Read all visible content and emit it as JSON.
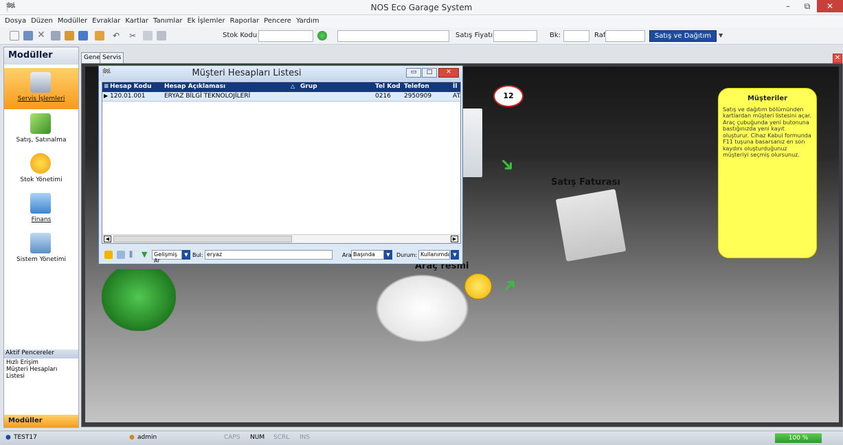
{
  "window": {
    "title": "NOS Eco Garage System",
    "controls": [
      "–",
      "⧉",
      "✕"
    ]
  },
  "menu": [
    "Dosya",
    "Düzen",
    "Modüller",
    "Evraklar",
    "Kartlar",
    "Tanımlar",
    "Ek İşlemler",
    "Raporlar",
    "Pencere",
    "Yardım"
  ],
  "toolbar": {
    "stok_kodu_label": "Stok Kodu",
    "stok_kodu_value": "",
    "satis_fiyati_label": "Satış Fiyatı",
    "bk_label": "Bk:",
    "raf_label": "Raf",
    "satis_dagitim": "Satış ve Dağıtım"
  },
  "sidebar": {
    "title": "Modüller",
    "modules": [
      {
        "label": "Servis İşlemleri",
        "icon": "wrench-icon"
      },
      {
        "label": "Satış, Satınalma",
        "icon": "pen-check-icon"
      },
      {
        "label": "Stok Yönetimi",
        "icon": "gear-icon"
      },
      {
        "label": "Finans",
        "icon": "folder-icon"
      },
      {
        "label": "Sistem Yönetimi",
        "icon": "system-icon"
      }
    ],
    "aktif_title": "Aktif Pencereler",
    "aktif_items": [
      "Hızlı Erişim",
      "Müşteri Hesapları Listesi"
    ],
    "footer": "Modüller"
  },
  "tabs": [
    "Genel",
    "Servis"
  ],
  "canvas": {
    "badge": "12",
    "fatura_label": "Satış Faturası",
    "arac_label": "Araç resmi",
    "info": {
      "title": "Müşteriler",
      "text": "Satış ve dağıtım bölümünden kartlardan müşteri listesini açar. Araç çubuğunda yeni butonuna bastığınızda yeni kayıt oluşturur. Cihaz Kabul formunda F11 tuşuna basarsanız en son kaydını oluşturduğunuz müşteriyi seçmiş olursunuz."
    }
  },
  "dialog": {
    "title": "Müşteri Hesapları Listesi",
    "columns": [
      "Hesap Kodu",
      "Hesap Açıklaması",
      "Grup",
      "Tel Kod",
      "Telefon",
      "İl"
    ],
    "rows": [
      {
        "hesap_kodu": "120.01.001",
        "aciklama": "ERYAZ BİLGİ TEKNOLOJİLERİ",
        "grup": "",
        "tel_kod": "0216",
        "telefon": "2950909",
        "il": "ATA"
      }
    ],
    "footer": {
      "gelismis": "Gelişmiş Ar",
      "bul_label": "Bul:",
      "bul_value": "eryaz",
      "ara_label": "Ara:",
      "ara_value": "Başında",
      "durum_label": "Durum:",
      "durum_value": "Kullanımda"
    }
  },
  "status": {
    "user": "TEST17",
    "admin": "admin",
    "caps": "CAPS",
    "num": "NUM",
    "scrl": "SCRL",
    "ins": "INS",
    "zoom": "100 %"
  }
}
